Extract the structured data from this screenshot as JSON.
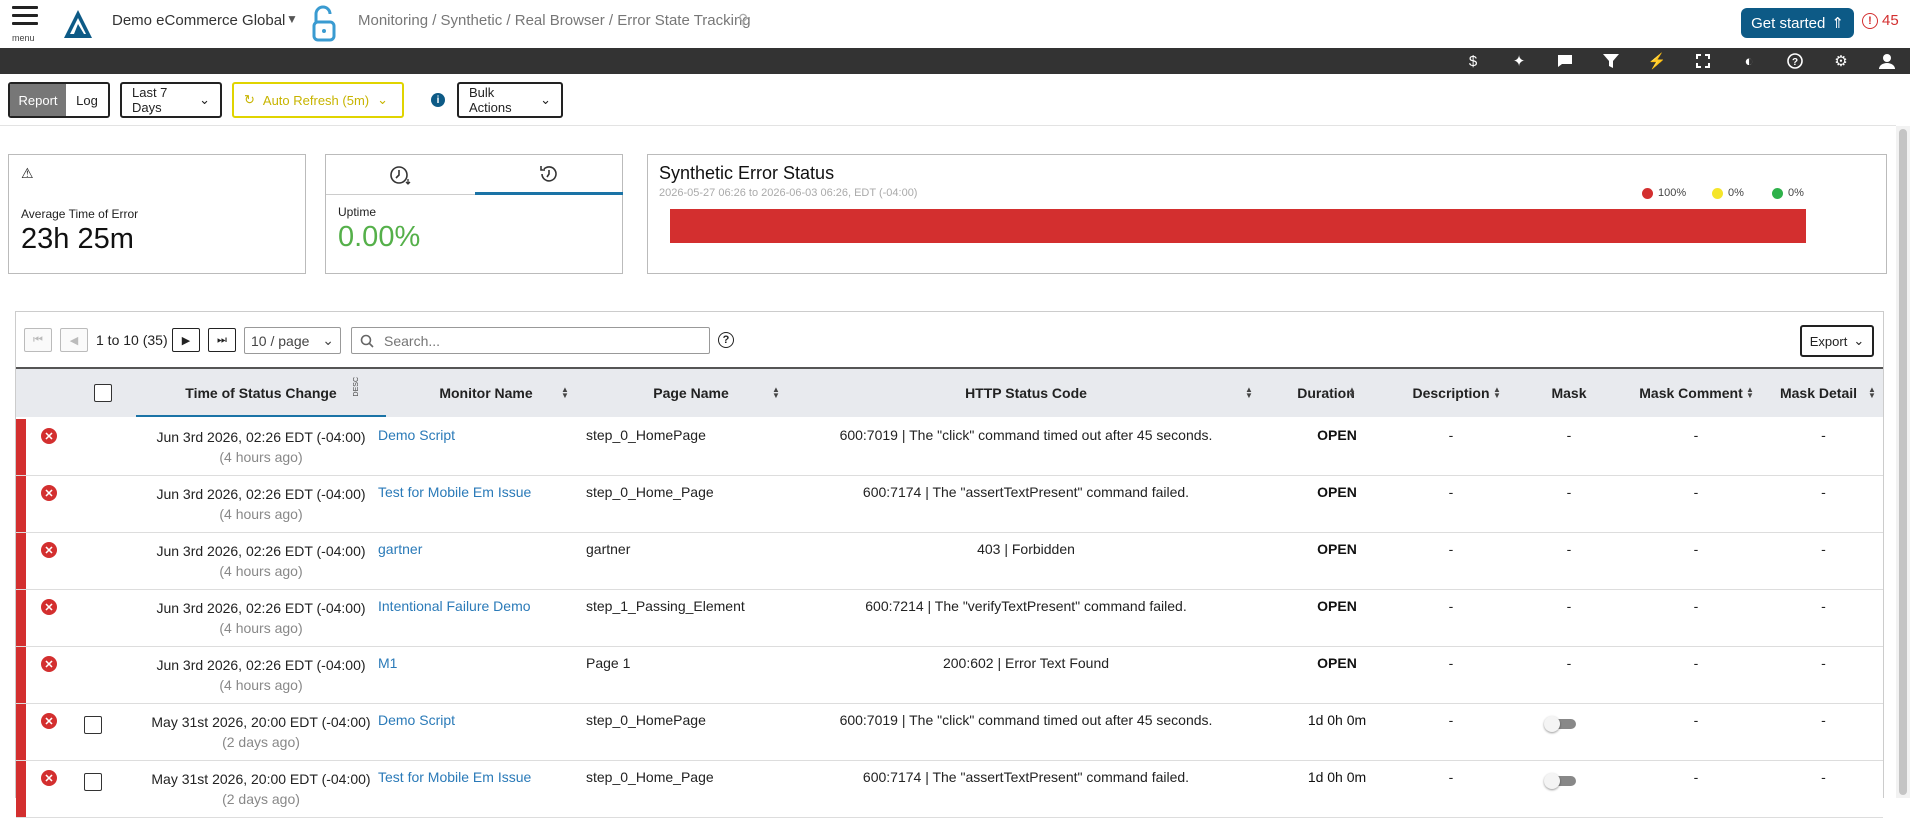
{
  "topbar": {
    "menu_label": "menu",
    "org_name": "Demo eCommerce Global",
    "breadcrumb": "Monitoring / Synthetic / Real Browser / Error State Tracking",
    "get_started_label": "Get started",
    "alert_count": "45"
  },
  "toolbar_icons": [
    "dollar-icon",
    "sparkles-icon",
    "chat-icon",
    "filter-icon",
    "lightning-icon",
    "fullscreen-icon",
    "contrast-icon",
    "help-icon",
    "gear-icon",
    "user-icon"
  ],
  "controls": {
    "view_report": "Report",
    "view_log": "Log",
    "date_range": "Last 7 Days",
    "auto_refresh": "Auto Refresh (5m)",
    "bulk_actions": "Bulk Actions"
  },
  "cards": {
    "avg_error_label": "Average Time of Error",
    "avg_error_value": "23h 25m",
    "uptime_label": "Uptime",
    "uptime_value": "0.00%",
    "status_title": "Synthetic Error Status",
    "status_range": "2026-05-27 06:26 to 2026-06-03 06:26, EDT (-04:00)",
    "legend": [
      {
        "label": "100%",
        "color": "#d32f2f"
      },
      {
        "label": "0%",
        "color": "#f5e52a"
      },
      {
        "label": "0%",
        "color": "#2eb14a"
      }
    ]
  },
  "status_distribution": {
    "error": 1.0,
    "warning": 0.0,
    "ok": 0.0
  },
  "table": {
    "page_count_text": "1 to 10 (35)",
    "page_size": "10 / page",
    "search_placeholder": "Search...",
    "export_label": "Export",
    "columns": {
      "time": "Time of Status Change",
      "time_sort": "DESC",
      "monitor": "Monitor Name",
      "page": "Page Name",
      "code": "HTTP Status Code",
      "duration": "Duration",
      "description": "Description",
      "mask": "Mask",
      "mask_comment": "Mask Comment",
      "mask_detail": "Mask Detail"
    },
    "rows": [
      {
        "time": "Jun 3rd 2026, 02:26 EDT (-04:00)",
        "ago": "(4 hours ago)",
        "monitor": "Demo Script",
        "page": "step_0_HomePage",
        "code": "600:7019 | The \"click\" command timed out after 45 seconds.",
        "duration": "OPEN",
        "description": "-",
        "mask": "-",
        "mask_comment": "-",
        "mask_detail": "-"
      },
      {
        "time": "Jun 3rd 2026, 02:26 EDT (-04:00)",
        "ago": "(4 hours ago)",
        "monitor": "Test for Mobile Em Issue",
        "page": "step_0_Home_Page",
        "code": "600:7174 | The \"assertTextPresent\" command failed.",
        "duration": "OPEN",
        "description": "-",
        "mask": "-",
        "mask_comment": "-",
        "mask_detail": "-"
      },
      {
        "time": "Jun 3rd 2026, 02:26 EDT (-04:00)",
        "ago": "(4 hours ago)",
        "monitor": "gartner",
        "page": "gartner",
        "code": "403 | Forbidden",
        "duration": "OPEN",
        "description": "-",
        "mask": "-",
        "mask_comment": "-",
        "mask_detail": "-"
      },
      {
        "time": "Jun 3rd 2026, 02:26 EDT (-04:00)",
        "ago": "(4 hours ago)",
        "monitor": "Intentional Failure Demo",
        "page": "step_1_Passing_Element",
        "code": "600:7214 | The \"verifyTextPresent\" command failed.",
        "duration": "OPEN",
        "description": "-",
        "mask": "-",
        "mask_comment": "-",
        "mask_detail": "-"
      },
      {
        "time": "Jun 3rd 2026, 02:26 EDT (-04:00)",
        "ago": "(4 hours ago)",
        "monitor": "M1",
        "page": "Page 1",
        "code": "200:602 | Error Text Found",
        "duration": "OPEN",
        "description": "-",
        "mask": "-",
        "mask_comment": "-",
        "mask_detail": "-"
      },
      {
        "time": "May 31st 2026, 20:00 EDT (-04:00)",
        "ago": "(2 days ago)",
        "monitor": "Demo Script",
        "page": "step_0_HomePage",
        "code": "600:7019 | The \"click\" command timed out after 45 seconds.",
        "duration": "1d 0h 0m",
        "description": "-",
        "mask": "",
        "mask_comment": "-",
        "mask_detail": "-"
      },
      {
        "time": "May 31st 2026, 20:00 EDT (-04:00)",
        "ago": "(2 days ago)",
        "monitor": "Test for Mobile Em Issue",
        "page": "step_0_Home_Page",
        "code": "600:7174 | The \"assertTextPresent\" command failed.",
        "duration": "1d 0h 0m",
        "description": "-",
        "mask": "",
        "mask_comment": "-",
        "mask_detail": "-"
      }
    ]
  }
}
